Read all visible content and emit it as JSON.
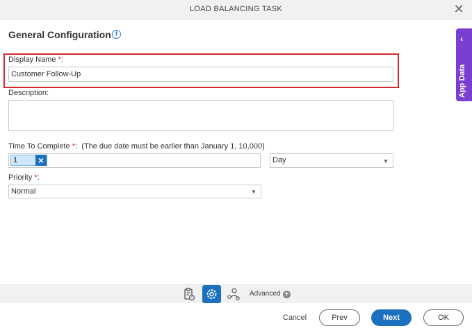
{
  "window": {
    "title": "LOAD BALANCING TASK",
    "close_glyph": "✕"
  },
  "section": {
    "title": "General Configuration",
    "info_glyph": "i"
  },
  "fields": {
    "display_name": {
      "label": "Display Name",
      "required_mark": "*",
      "suffix": ":",
      "value": "Customer Follow-Up"
    },
    "description": {
      "label": "Description:",
      "value": ""
    },
    "time_to_complete": {
      "label": "Time To Complete",
      "required_mark": "*",
      "suffix": ":",
      "hint": "(The due date must be earlier than January 1, 10,000)",
      "value": "1",
      "unit": "Day"
    },
    "priority": {
      "label": "Priority",
      "required_mark": "*",
      "suffix": ":",
      "value": "Normal"
    }
  },
  "side_panel": {
    "label": "App Data"
  },
  "toolbar": {
    "advanced_label": "Advanced"
  },
  "buttons": {
    "cancel": "Cancel",
    "prev": "Prev",
    "next": "Next",
    "ok": "OK"
  },
  "colors": {
    "accent": "#1d70c0",
    "highlight": "#d9262c",
    "side_tab": "#7a3fd1"
  },
  "icons": [
    "close-icon",
    "info-icon",
    "chevron-left-icon",
    "remove-tag-icon",
    "dropdown-arrow-icon",
    "task-clipboard-icon",
    "settings-gear-icon",
    "assignee-icon",
    "plus-circle-icon"
  ]
}
